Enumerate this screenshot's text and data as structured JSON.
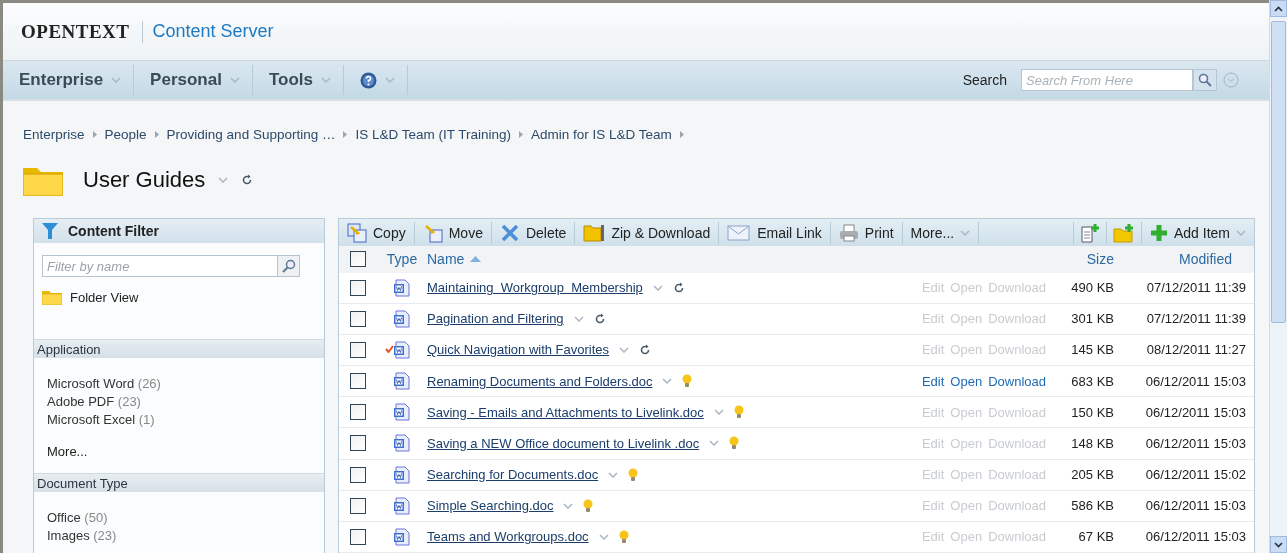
{
  "header": {
    "brand": "OPENTEXT",
    "product": "Content Server"
  },
  "nav": {
    "menus": [
      {
        "label": "Enterprise"
      },
      {
        "label": "Personal"
      },
      {
        "label": "Tools"
      }
    ],
    "search_label": "Search",
    "search_placeholder": "Search From Here"
  },
  "breadcrumb": [
    "Enterprise",
    "People",
    "Providing and Supporting …",
    "IS L&D Team (IT Training)",
    "Admin for IS L&D Team"
  ],
  "folder": {
    "title": "User Guides"
  },
  "filter": {
    "title": "Content Filter",
    "placeholder": "Filter by name",
    "folder_view": "Folder View",
    "sections": [
      {
        "title": "Application",
        "items": [
          {
            "label": "Microsoft Word",
            "count": "(26)"
          },
          {
            "label": "Adobe PDF",
            "count": "(23)"
          },
          {
            "label": "Microsoft Excel",
            "count": "(1)"
          }
        ],
        "more": "More..."
      },
      {
        "title": "Document Type",
        "items": [
          {
            "label": "Office",
            "count": "(50)"
          },
          {
            "label": "Images",
            "count": "(23)"
          }
        ]
      }
    ]
  },
  "toolbar": {
    "actions": [
      {
        "kind": "copy",
        "label": "Copy"
      },
      {
        "kind": "move",
        "label": "Move"
      },
      {
        "kind": "delete",
        "label": "Delete"
      },
      {
        "kind": "zip",
        "label": "Zip & Download"
      },
      {
        "kind": "email",
        "label": "Email Link"
      },
      {
        "kind": "print",
        "label": "Print"
      }
    ],
    "more": "More...",
    "add_item": "Add Item"
  },
  "table": {
    "select_all_checked": false,
    "columns": {
      "type": "Type",
      "name": "Name",
      "size": "Size",
      "modified": "Modified"
    },
    "rows": [
      {
        "checked": false,
        "name": "Maintaining  Workgroup  Membership",
        "kind": "refresh",
        "favorite": false,
        "actions": [
          "Edit",
          "Open",
          "Download"
        ],
        "actions_enabled": false,
        "size": "490 KB",
        "modified": "07/12/2011 11:39"
      },
      {
        "checked": false,
        "name": "Pagination and Filtering",
        "kind": "refresh",
        "favorite": false,
        "actions": [
          "Edit",
          "Open",
          "Download"
        ],
        "actions_enabled": false,
        "size": "301 KB",
        "modified": "07/12/2011 11:39"
      },
      {
        "checked": false,
        "name": "Quick Navigation with Favorites",
        "kind": "refresh",
        "favorite": true,
        "actions": [
          "Edit",
          "Open",
          "Download"
        ],
        "actions_enabled": false,
        "size": "145 KB",
        "modified": "08/12/2011 11:27"
      },
      {
        "checked": false,
        "name": "Renaming Documents and Folders.doc",
        "kind": "bulb",
        "favorite": false,
        "actions": [
          "Edit",
          "Open",
          "Download"
        ],
        "actions_enabled": true,
        "size": "683 KB",
        "modified": "06/12/2011 15:03"
      },
      {
        "checked": false,
        "name": "Saving - Emails and Attachments to Livelink.doc",
        "kind": "bulb",
        "favorite": false,
        "actions": [
          "Edit",
          "Open",
          "Download"
        ],
        "actions_enabled": false,
        "size": "150 KB",
        "modified": "06/12/2011 15:03"
      },
      {
        "checked": false,
        "name": "Saving a NEW Office document to Livelink .doc",
        "kind": "bulb",
        "favorite": false,
        "actions": [
          "Edit",
          "Open",
          "Download"
        ],
        "actions_enabled": false,
        "size": "148 KB",
        "modified": "06/12/2011 15:03"
      },
      {
        "checked": false,
        "name": "Searching for Documents.doc",
        "kind": "bulb",
        "favorite": false,
        "actions": [
          "Edit",
          "Open",
          "Download"
        ],
        "actions_enabled": false,
        "size": "205 KB",
        "modified": "06/12/2011 15:02"
      },
      {
        "checked": false,
        "name": "Simple Searching.doc",
        "kind": "bulb",
        "favorite": false,
        "actions": [
          "Edit",
          "Open",
          "Download"
        ],
        "actions_enabled": false,
        "size": "586 KB",
        "modified": "06/12/2011 15:03"
      },
      {
        "checked": false,
        "name": "Teams and Workgroups.doc",
        "kind": "bulb",
        "favorite": false,
        "actions": [
          "Edit",
          "Open",
          "Download"
        ],
        "actions_enabled": false,
        "size": "67 KB",
        "modified": "06/12/2011 15:03"
      }
    ]
  }
}
